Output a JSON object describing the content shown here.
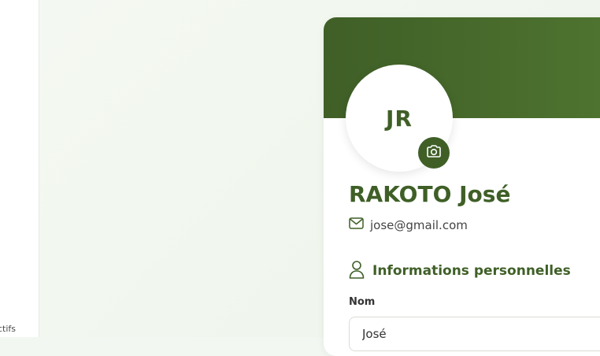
{
  "sidebar": {
    "footer_text": "ctifs"
  },
  "profile": {
    "initials": "JR",
    "name": "RAKOTO José",
    "email": "jose@gmail.com"
  },
  "section": {
    "title": "Informations personnelles"
  },
  "form": {
    "nom_label": "Nom",
    "nom_value": "José"
  },
  "colors": {
    "accent": "#3f5f27",
    "banner": "#4f7430",
    "background": "#f3f7f1"
  },
  "icons": {
    "camera": "camera-icon",
    "mail": "mail-icon",
    "user": "user-icon"
  }
}
